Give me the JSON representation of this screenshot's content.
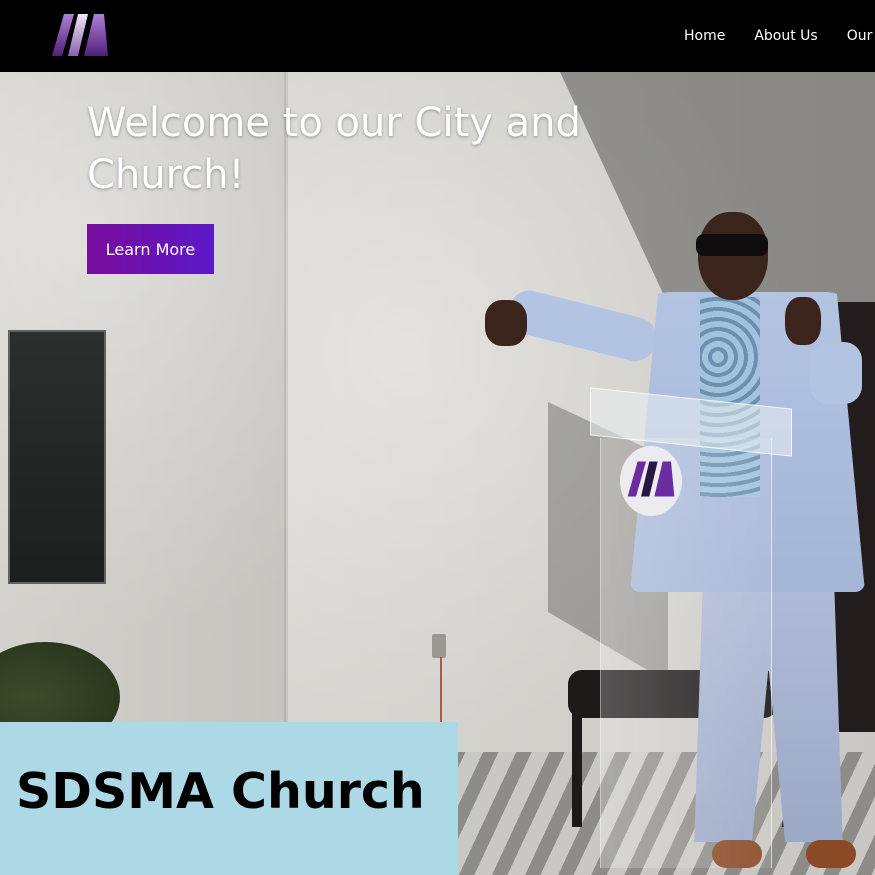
{
  "nav": {
    "logo_alt": "M logo",
    "items": [
      {
        "label": "Home"
      },
      {
        "label": "About Us"
      },
      {
        "label": "Our"
      }
    ]
  },
  "hero": {
    "title": "Welcome to our City and Church!",
    "button_label": "Learn More"
  },
  "caption": {
    "text": "SDSMA Church"
  },
  "colors": {
    "nav_background": "#000000",
    "button_gradient_start": "#7a0c9e",
    "button_gradient_end": "#5b18c8",
    "caption_background": "#add8e6",
    "logo_purple": "#6a2ca0"
  }
}
